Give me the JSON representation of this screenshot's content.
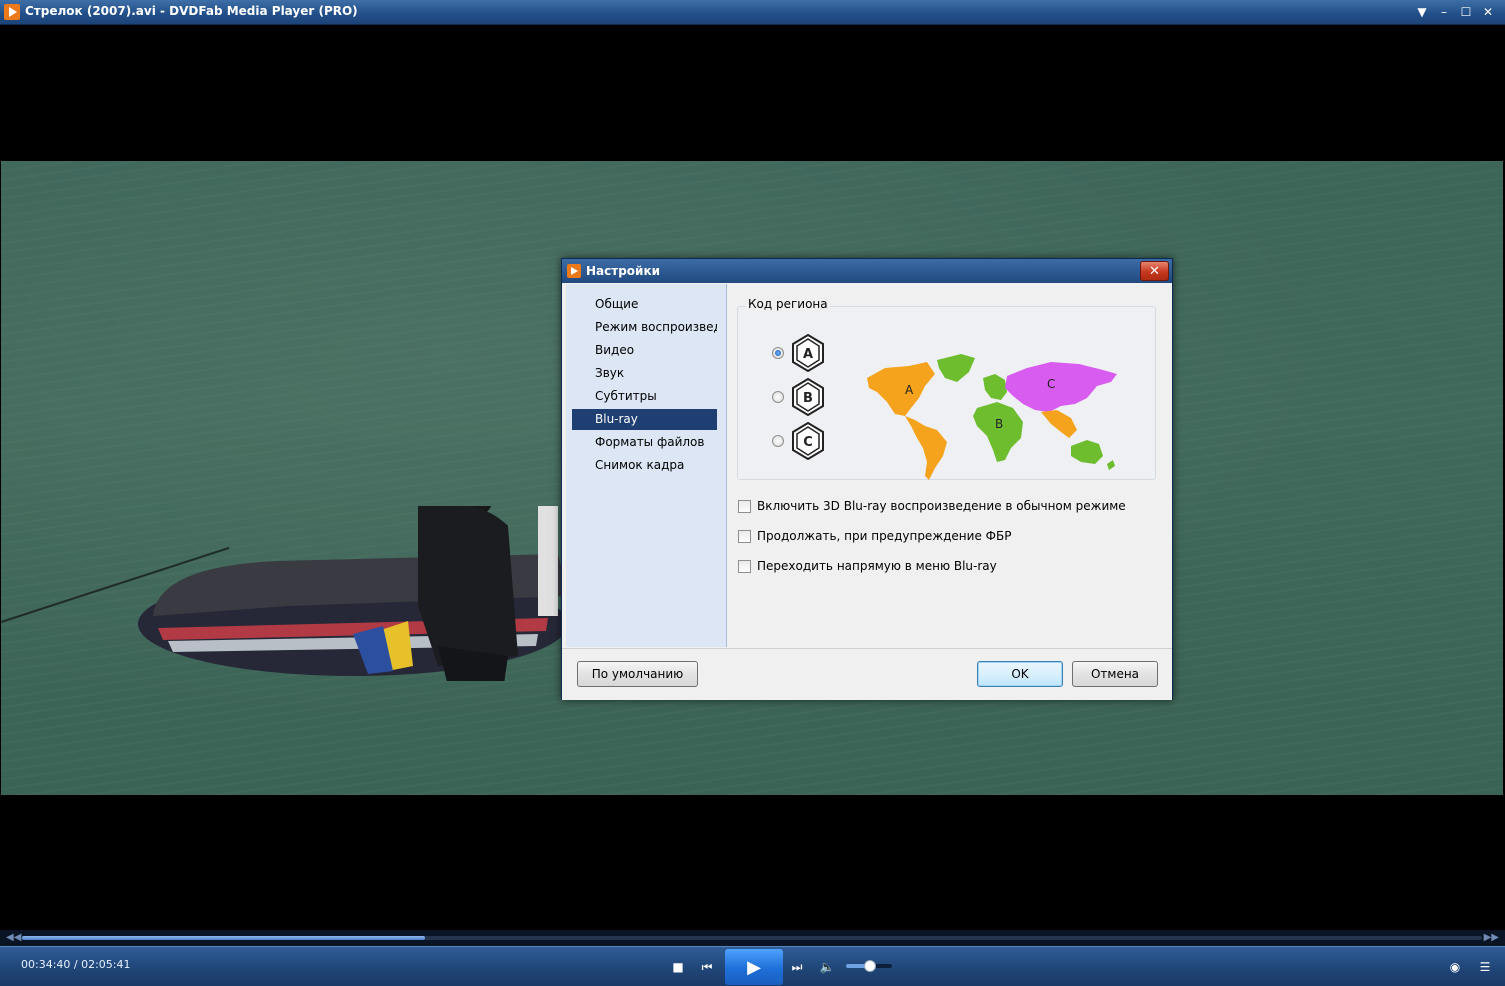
{
  "window": {
    "title": "Стрелок (2007).avi - DVDFab Media Player (PRO)",
    "controls": {
      "menu": "▼",
      "minimize": "–",
      "maximize": "☐",
      "close": "✕"
    }
  },
  "playback": {
    "time": "00:34:40 / 02:05:41",
    "progress": 0.276,
    "volume": 0.5,
    "icons": {
      "seek_back": "◀◀",
      "seek_forward": "▶▶",
      "stop": "■",
      "previous": "⏮",
      "play": "▶",
      "next": "⏭",
      "volume": "🔈",
      "view": "◉",
      "playlist": "☰"
    }
  },
  "dialog": {
    "title": "Настройки",
    "close": "✕",
    "nav": [
      "Общие",
      "Режим воспроизвед.",
      "Видео",
      "Звук",
      "Субтитры",
      "Blu-ray",
      "Форматы файлов",
      "Снимок кадра"
    ],
    "selected_nav": 5,
    "region": {
      "legend": "Код региона",
      "options": [
        "A",
        "B",
        "C"
      ],
      "selected": 0,
      "map_labels": {
        "a": "A",
        "b": "B",
        "c": "C"
      },
      "colors": {
        "a": "#f5a31c",
        "b": "#6dbd2f",
        "c": "#d85cf0"
      }
    },
    "options": [
      {
        "label": "Включить 3D Blu-ray воспроизведение в обычном режиме",
        "checked": false
      },
      {
        "label": "Продолжать, при предупреждение ФБР",
        "checked": false
      },
      {
        "label": "Переходить напрямую в меню Blu-ray",
        "checked": false
      }
    ],
    "buttons": {
      "defaults": "По умолчанию",
      "ok": "OK",
      "cancel": "Отмена"
    }
  }
}
